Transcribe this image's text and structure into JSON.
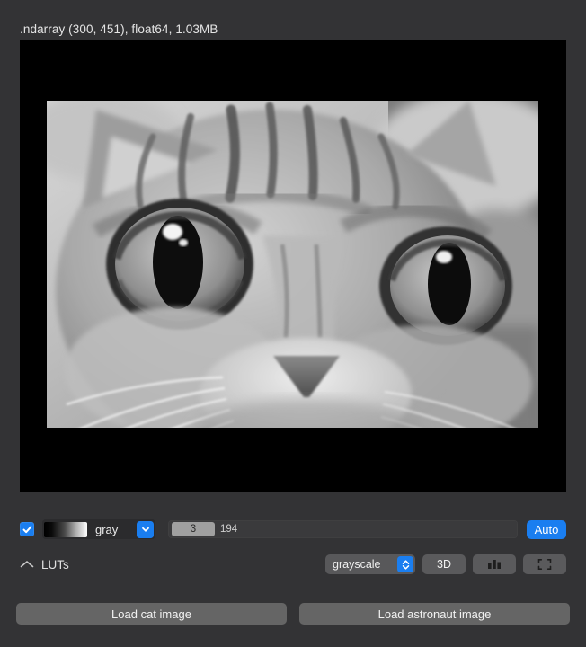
{
  "header": {
    "title": ".ndarray (300, 451), float64, 1.03MB"
  },
  "canvas": {
    "background_color": "#000000",
    "image_alt": "grayscale cat photograph"
  },
  "lut_row": {
    "enabled_checkbox": true,
    "checkbox_icon": "checkmark-icon",
    "colormap_name": "gray",
    "colormap_gradient_start": "#000000",
    "colormap_gradient_end": "#ffffff",
    "dropdown_icon": "chevron-down-icon",
    "contrast_limits": {
      "low": "3",
      "high": "194"
    },
    "auto_label": "Auto",
    "accent_color": "#1a7ef0"
  },
  "tools_row": {
    "luts_toggle_icon": "chevron-up-icon",
    "luts_label": "LUTs",
    "colormap_select_value": "grayscale",
    "colormap_select_options": [
      "grayscale"
    ],
    "select_stepper_icon": "chevron-up-down-icon",
    "buttons": [
      {
        "label": "3D",
        "icon": null,
        "name": "toggle-3d-button"
      },
      {
        "label": "",
        "icon": "histogram-icon",
        "name": "histogram-button"
      },
      {
        "label": "",
        "icon": "expand-icon",
        "name": "reset-view-button"
      }
    ]
  },
  "bottom_row": {
    "load_cat_label": "Load cat image",
    "load_astronaut_label": "Load astronaut image"
  }
}
